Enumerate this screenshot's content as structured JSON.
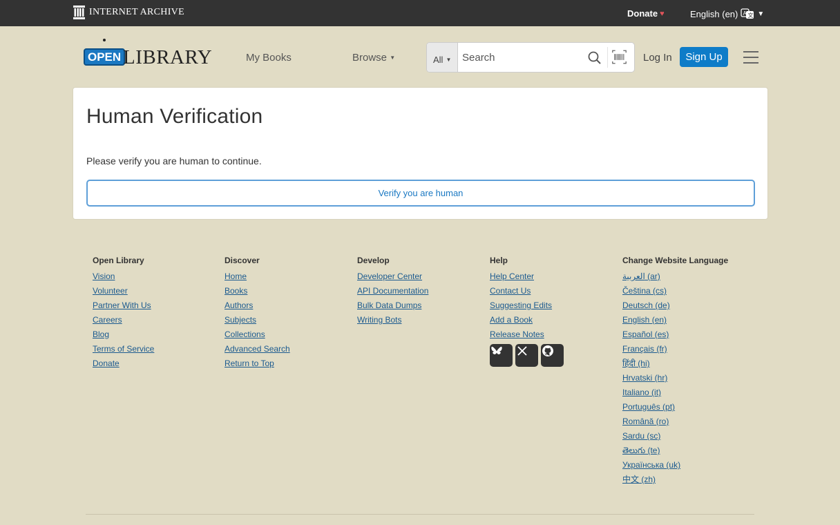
{
  "ia_bar": {
    "logo_text": "INTERNET ARCHIVE",
    "donate_label": "Donate",
    "language_label": "English (en)"
  },
  "header": {
    "logo_open": "OPEN",
    "logo_library": "LIBRARY",
    "my_books": "My Books",
    "browse": "Browse",
    "search_scope": "All",
    "search_placeholder": "Search",
    "login": "Log In",
    "signup": "Sign Up"
  },
  "main": {
    "title": "Human Verification",
    "message": "Please verify you are human to continue.",
    "verify_button": "Verify you are human"
  },
  "footer": {
    "columns": [
      {
        "heading": "Open Library",
        "links": [
          "Vision",
          "Volunteer",
          "Partner With Us",
          "Careers",
          "Blog",
          "Terms of Service",
          "Donate"
        ]
      },
      {
        "heading": "Discover",
        "links": [
          "Home",
          "Books",
          "Authors",
          "Subjects",
          "Collections",
          "Advanced Search",
          "Return to Top"
        ]
      },
      {
        "heading": "Develop",
        "links": [
          "Developer Center",
          "API Documentation",
          "Bulk Data Dumps",
          "Writing Bots"
        ]
      },
      {
        "heading": "Help",
        "links": [
          "Help Center",
          "Contact Us",
          "Suggesting Edits",
          "Add a Book",
          "Release Notes"
        ]
      },
      {
        "heading": "Change Website Language",
        "links": [
          "العربية (ar)",
          "Čeština (cs)",
          "Deutsch (de)",
          "English (en)",
          "Español (es)",
          "Français (fr)",
          "हिंदी (hi)",
          "Hrvatski (hr)",
          "Italiano (it)",
          "Português (pt)",
          "Română (ro)",
          "Sardu (sc)",
          "తెలుగు (te)",
          "Українська (uk)",
          "中文 (zh)"
        ]
      }
    ],
    "social_icons": [
      "bluesky-icon",
      "x-icon",
      "github-icon"
    ]
  },
  "colors": {
    "page_bg": "#e1dcc5",
    "top_bar": "#333333",
    "accent_blue": "#0e7cc8",
    "link": "#1b5a8f"
  }
}
